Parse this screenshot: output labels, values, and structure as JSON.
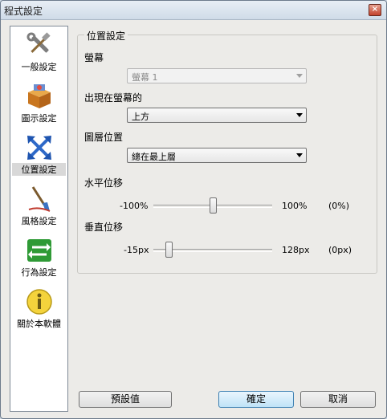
{
  "window": {
    "title": "程式設定",
    "close_label": "×"
  },
  "sidebar": {
    "items": [
      {
        "label": "一般設定",
        "icon": "tools-icon"
      },
      {
        "label": "圖示設定",
        "icon": "box-icon"
      },
      {
        "label": "位置設定",
        "icon": "move-arrows-icon",
        "active": true
      },
      {
        "label": "風格設定",
        "icon": "paintbrush-icon"
      },
      {
        "label": "行為設定",
        "icon": "swap-arrows-icon"
      },
      {
        "label": "關於本軟體",
        "icon": "info-icon"
      }
    ]
  },
  "panel": {
    "group_title": "位置設定",
    "screen": {
      "label": "螢幕",
      "value": "螢幕 1",
      "disabled": true
    },
    "appear": {
      "label": "出現在螢幕的",
      "value": "上方"
    },
    "layer": {
      "label": "圖層位置",
      "value": "總在最上層"
    },
    "h_offset": {
      "label": "水平位移",
      "min": "-100%",
      "max": "100%",
      "current": "(0%)",
      "fraction": 0.5
    },
    "v_offset": {
      "label": "垂直位移",
      "min": "-15px",
      "max": "128px",
      "current": "(0px)",
      "fraction": 0.105
    }
  },
  "buttons": {
    "default": "預設值",
    "ok": "確定",
    "cancel": "取消"
  },
  "colors": {
    "title_bar": "#dbe5ef",
    "accent": "#3c7fb1",
    "window_bg": "#ecebe8"
  }
}
